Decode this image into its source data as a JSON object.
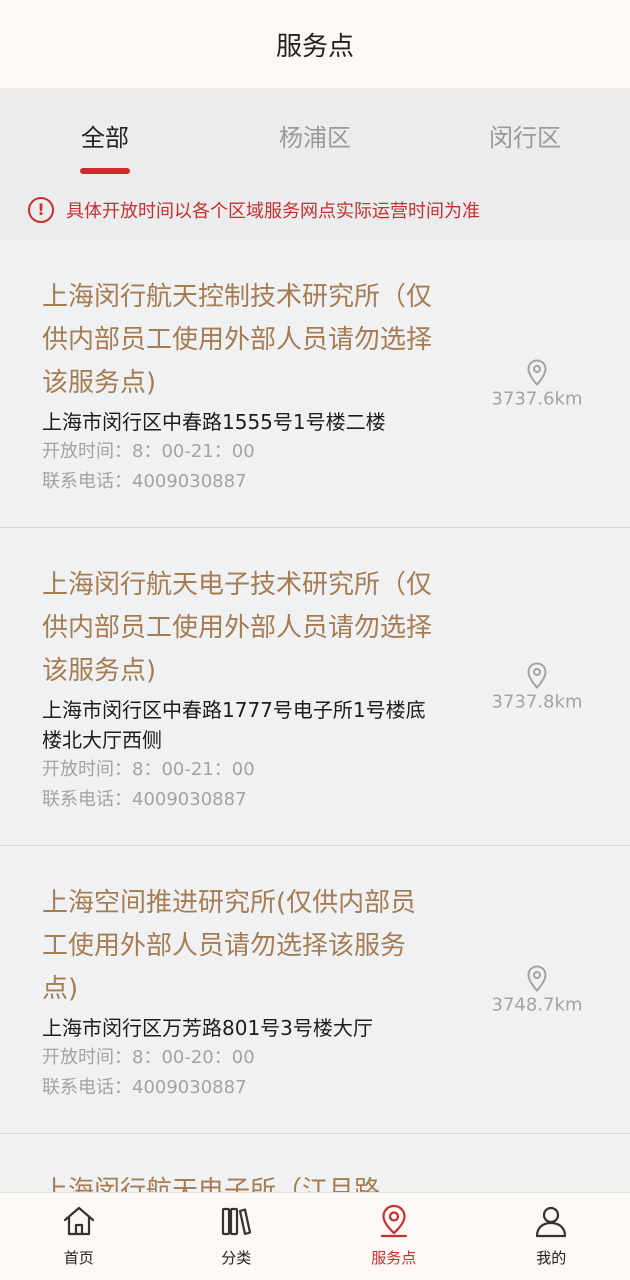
{
  "header": {
    "title": "服务点"
  },
  "tabs": [
    {
      "label": "全部",
      "active": true
    },
    {
      "label": "杨浦区",
      "active": false
    },
    {
      "label": "闵行区",
      "active": false
    }
  ],
  "notice": {
    "text": "具体开放时间以各个区域服务网点实际运营时间为准",
    "icon": "alert-circle-icon"
  },
  "list": {
    "items": [
      {
        "title": "上海闵行航天控制技术研究所（仅供内部员工使用外部人员请勿选择该服务点)",
        "address": "上海市闵行区中春路1555号1号楼二楼",
        "hours": "开放时间：8：00-21：00",
        "phone": "联系电话：4009030887",
        "distance": "3737.6km"
      },
      {
        "title": "上海闵行航天电子技术研究所（仅供内部员工使用外部人员请勿选择该服务点)",
        "address": "上海市闵行区中春路1777号电子所1号楼底楼北大厅西侧",
        "hours": "开放时间：8：00-21：00",
        "phone": "联系电话：4009030887",
        "distance": "3737.8km"
      },
      {
        "title": "上海空间推进研究所(仅供内部员工使用外部人员请勿选择该服务点)",
        "address": "上海市闵行区万芳路801号3号楼大厅",
        "hours": "开放时间：8：00-20：00",
        "phone": "联系电话：4009030887",
        "distance": "3748.7km"
      },
      {
        "title": "上海闵行航天电子所（江月路",
        "address": "",
        "hours": "",
        "phone": "",
        "distance": ""
      }
    ]
  },
  "bottom_nav": [
    {
      "label": "首页",
      "icon": "home-icon",
      "active": false
    },
    {
      "label": "分类",
      "icon": "books-icon",
      "active": false
    },
    {
      "label": "服务点",
      "icon": "location-pin-icon",
      "active": true
    },
    {
      "label": "我的",
      "icon": "user-icon",
      "active": false
    }
  ],
  "colors": {
    "accent": "#c8302e",
    "title": "#a67c52",
    "muted": "#a3a3a3"
  }
}
